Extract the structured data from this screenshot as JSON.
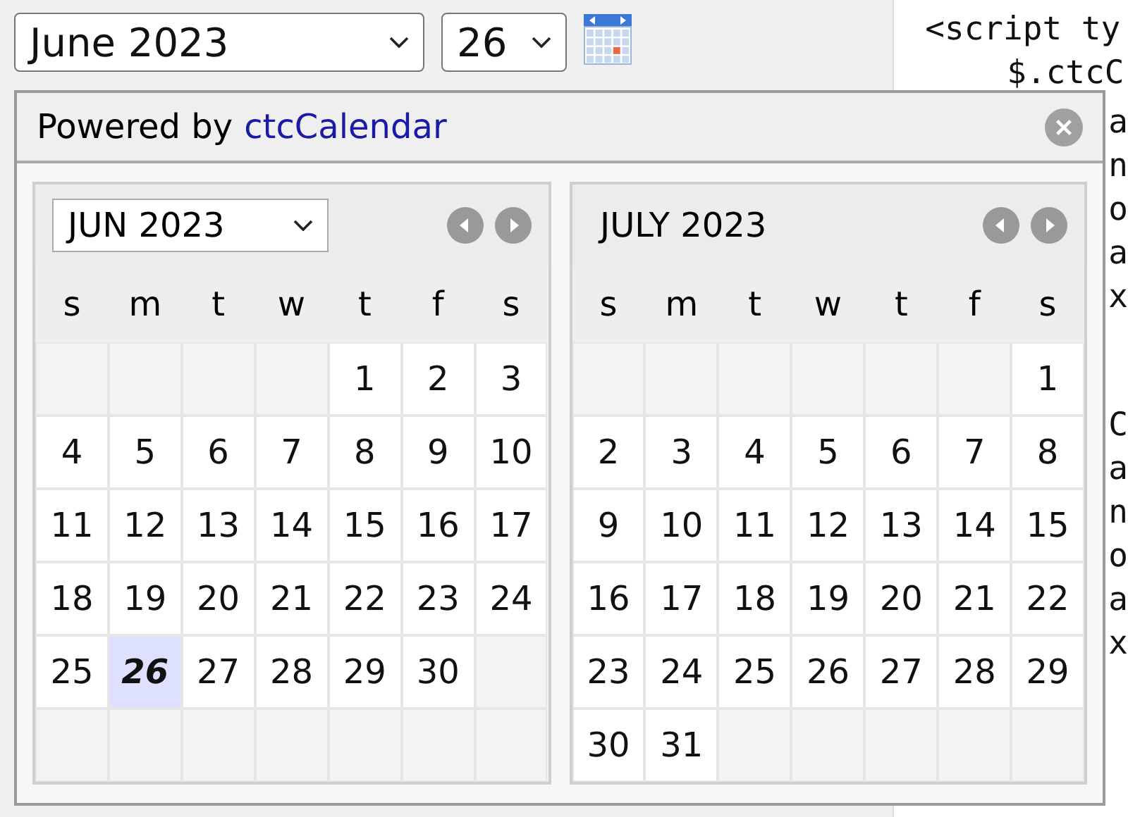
{
  "date_picker": {
    "month_select": "June 2023",
    "day_select": "26"
  },
  "code": {
    "lines": [
      "<script ty",
      "$.ctcC"
    ],
    "block_1": [
      "a",
      "n",
      "o",
      "a",
      "x"
    ],
    "block_2": [
      "C",
      "a",
      "n",
      "o",
      "a",
      "x"
    ]
  },
  "popup": {
    "powered_by": "Powered by",
    "brand_link": "ctcCalendar",
    "months": [
      {
        "kind": "select",
        "label": "JUN 2023",
        "weekdays": [
          "s",
          "m",
          "t",
          "w",
          "t",
          "f",
          "s"
        ],
        "weeks": [
          [
            {
              "kind": "blank"
            },
            {
              "kind": "blank"
            },
            {
              "kind": "blank"
            },
            {
              "kind": "blank"
            },
            {
              "kind": "day",
              "day": "1",
              "selected": false
            },
            {
              "kind": "day",
              "day": "2",
              "selected": false
            },
            {
              "kind": "day",
              "day": "3",
              "selected": false
            }
          ],
          [
            {
              "kind": "day",
              "day": "4",
              "selected": false
            },
            {
              "kind": "day",
              "day": "5",
              "selected": false
            },
            {
              "kind": "day",
              "day": "6",
              "selected": false
            },
            {
              "kind": "day",
              "day": "7",
              "selected": false
            },
            {
              "kind": "day",
              "day": "8",
              "selected": false
            },
            {
              "kind": "day",
              "day": "9",
              "selected": false
            },
            {
              "kind": "day",
              "day": "10",
              "selected": false
            }
          ],
          [
            {
              "kind": "day",
              "day": "11",
              "selected": false
            },
            {
              "kind": "day",
              "day": "12",
              "selected": false
            },
            {
              "kind": "day",
              "day": "13",
              "selected": false
            },
            {
              "kind": "day",
              "day": "14",
              "selected": false
            },
            {
              "kind": "day",
              "day": "15",
              "selected": false
            },
            {
              "kind": "day",
              "day": "16",
              "selected": false
            },
            {
              "kind": "day",
              "day": "17",
              "selected": false
            }
          ],
          [
            {
              "kind": "day",
              "day": "18",
              "selected": false
            },
            {
              "kind": "day",
              "day": "19",
              "selected": false
            },
            {
              "kind": "day",
              "day": "20",
              "selected": false
            },
            {
              "kind": "day",
              "day": "21",
              "selected": false
            },
            {
              "kind": "day",
              "day": "22",
              "selected": false
            },
            {
              "kind": "day",
              "day": "23",
              "selected": false
            },
            {
              "kind": "day",
              "day": "24",
              "selected": false
            }
          ],
          [
            {
              "kind": "day",
              "day": "25",
              "selected": false
            },
            {
              "kind": "day",
              "day": "26",
              "selected": true
            },
            {
              "kind": "day",
              "day": "27",
              "selected": false
            },
            {
              "kind": "day",
              "day": "28",
              "selected": false
            },
            {
              "kind": "day",
              "day": "29",
              "selected": false
            },
            {
              "kind": "day",
              "day": "30",
              "selected": false
            },
            {
              "kind": "blank"
            }
          ],
          [
            {
              "kind": "blank"
            },
            {
              "kind": "blank"
            },
            {
              "kind": "blank"
            },
            {
              "kind": "blank"
            },
            {
              "kind": "blank"
            },
            {
              "kind": "blank"
            },
            {
              "kind": "blank"
            }
          ]
        ]
      },
      {
        "kind": "text",
        "label": "JULY 2023",
        "weekdays": [
          "s",
          "m",
          "t",
          "w",
          "t",
          "f",
          "s"
        ],
        "weeks": [
          [
            {
              "kind": "blank"
            },
            {
              "kind": "blank"
            },
            {
              "kind": "blank"
            },
            {
              "kind": "blank"
            },
            {
              "kind": "blank"
            },
            {
              "kind": "blank"
            },
            {
              "kind": "day",
              "day": "1",
              "selected": false
            }
          ],
          [
            {
              "kind": "day",
              "day": "2",
              "selected": false
            },
            {
              "kind": "day",
              "day": "3",
              "selected": false
            },
            {
              "kind": "day",
              "day": "4",
              "selected": false
            },
            {
              "kind": "day",
              "day": "5",
              "selected": false
            },
            {
              "kind": "day",
              "day": "6",
              "selected": false
            },
            {
              "kind": "day",
              "day": "7",
              "selected": false
            },
            {
              "kind": "day",
              "day": "8",
              "selected": false
            }
          ],
          [
            {
              "kind": "day",
              "day": "9",
              "selected": false
            },
            {
              "kind": "day",
              "day": "10",
              "selected": false
            },
            {
              "kind": "day",
              "day": "11",
              "selected": false
            },
            {
              "kind": "day",
              "day": "12",
              "selected": false
            },
            {
              "kind": "day",
              "day": "13",
              "selected": false
            },
            {
              "kind": "day",
              "day": "14",
              "selected": false
            },
            {
              "kind": "day",
              "day": "15",
              "selected": false
            }
          ],
          [
            {
              "kind": "day",
              "day": "16",
              "selected": false
            },
            {
              "kind": "day",
              "day": "17",
              "selected": false
            },
            {
              "kind": "day",
              "day": "18",
              "selected": false
            },
            {
              "kind": "day",
              "day": "19",
              "selected": false
            },
            {
              "kind": "day",
              "day": "20",
              "selected": false
            },
            {
              "kind": "day",
              "day": "21",
              "selected": false
            },
            {
              "kind": "day",
              "day": "22",
              "selected": false
            }
          ],
          [
            {
              "kind": "day",
              "day": "23",
              "selected": false
            },
            {
              "kind": "day",
              "day": "24",
              "selected": false
            },
            {
              "kind": "day",
              "day": "25",
              "selected": false
            },
            {
              "kind": "day",
              "day": "26",
              "selected": false
            },
            {
              "kind": "day",
              "day": "27",
              "selected": false
            },
            {
              "kind": "day",
              "day": "28",
              "selected": false
            },
            {
              "kind": "day",
              "day": "29",
              "selected": false
            }
          ],
          [
            {
              "kind": "day",
              "day": "30",
              "selected": false
            },
            {
              "kind": "day",
              "day": "31",
              "selected": false
            },
            {
              "kind": "blank"
            },
            {
              "kind": "blank"
            },
            {
              "kind": "blank"
            },
            {
              "kind": "blank"
            },
            {
              "kind": "blank"
            }
          ]
        ]
      }
    ]
  }
}
